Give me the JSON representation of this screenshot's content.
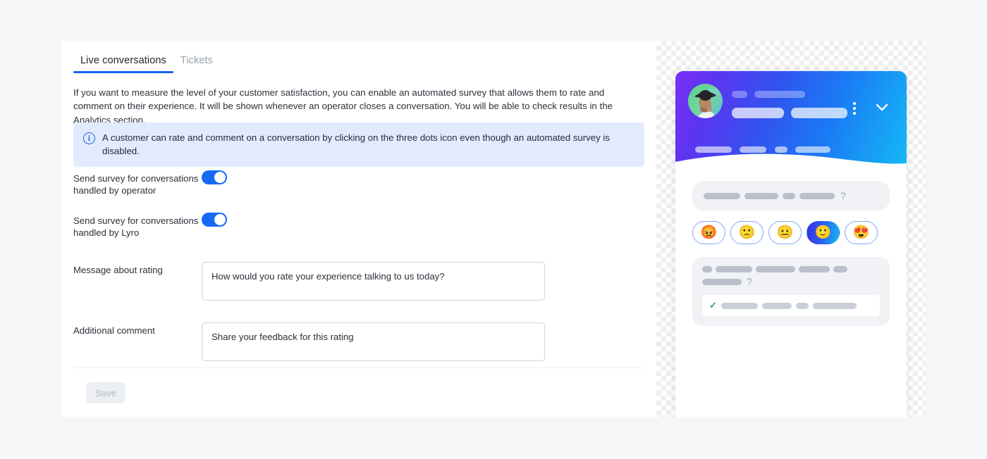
{
  "tabs": [
    {
      "label": "Live conversations",
      "active": true
    },
    {
      "label": "Tickets",
      "active": false
    }
  ],
  "intro_text": "If you want to measure the level of your customer satisfaction, you can enable an automated survey that allows them to rate and comment on their experience. It will be shown whenever an operator closes a conversation. You will be able to check results in the Analytics section.",
  "info_banner": {
    "icon": "info-circle-icon",
    "text": "A customer can rate and comment on a conversation by clicking on the three dots icon even though an automated survey is disabled."
  },
  "settings": {
    "operator_toggle": {
      "label": "Send survey for conversations handled by operator",
      "state": "on"
    },
    "lyro_toggle": {
      "label": "Send survey for conversations handled by Lyro",
      "state": "on"
    },
    "message_about_rating": {
      "label": "Message about rating",
      "value": "How would you rate your experience talking to us today?",
      "placeholder": "How would you rate your experience talking to us today?"
    },
    "additional_comment": {
      "label": "Additional comment",
      "value": "Share your feedback for this rating",
      "placeholder": "Share your feedback for this rating"
    }
  },
  "save_button": {
    "label": "Save",
    "disabled": true
  },
  "preview": {
    "header": {
      "avatar": "agent-avatar",
      "kebab_icon": "three-dots-vertical-icon",
      "chevron_icon": "chevron-down-icon",
      "accent_gradient_start": "#7b2ff7",
      "accent_gradient_end": "#15b8f5",
      "placeholder_bars_row1": [
        22,
        72
      ],
      "placeholder_bars_row2": [
        74,
        80
      ],
      "placeholder_bars_row3": [
        52,
        38,
        18,
        50
      ]
    },
    "message_bubble": {
      "placeholder_bars": [
        52,
        48,
        18,
        50
      ],
      "question_mark": "?"
    },
    "emojis": [
      {
        "name": "angry-face",
        "glyph": "😡",
        "selected": false
      },
      {
        "name": "slightly-frowning-face",
        "glyph": "🙁",
        "selected": false
      },
      {
        "name": "neutral-face",
        "glyph": "😐",
        "selected": false
      },
      {
        "name": "slightly-smiling-face",
        "glyph": "🙂",
        "selected": true
      },
      {
        "name": "heart-eyes-face",
        "glyph": "😍",
        "selected": false
      }
    ],
    "comment_bubble": {
      "placeholder_bars": [
        14,
        52,
        56,
        44,
        20,
        56
      ],
      "question_mark": "?",
      "input_check_icon": "check-icon",
      "input_bars": [
        52,
        42,
        18,
        62
      ]
    }
  }
}
